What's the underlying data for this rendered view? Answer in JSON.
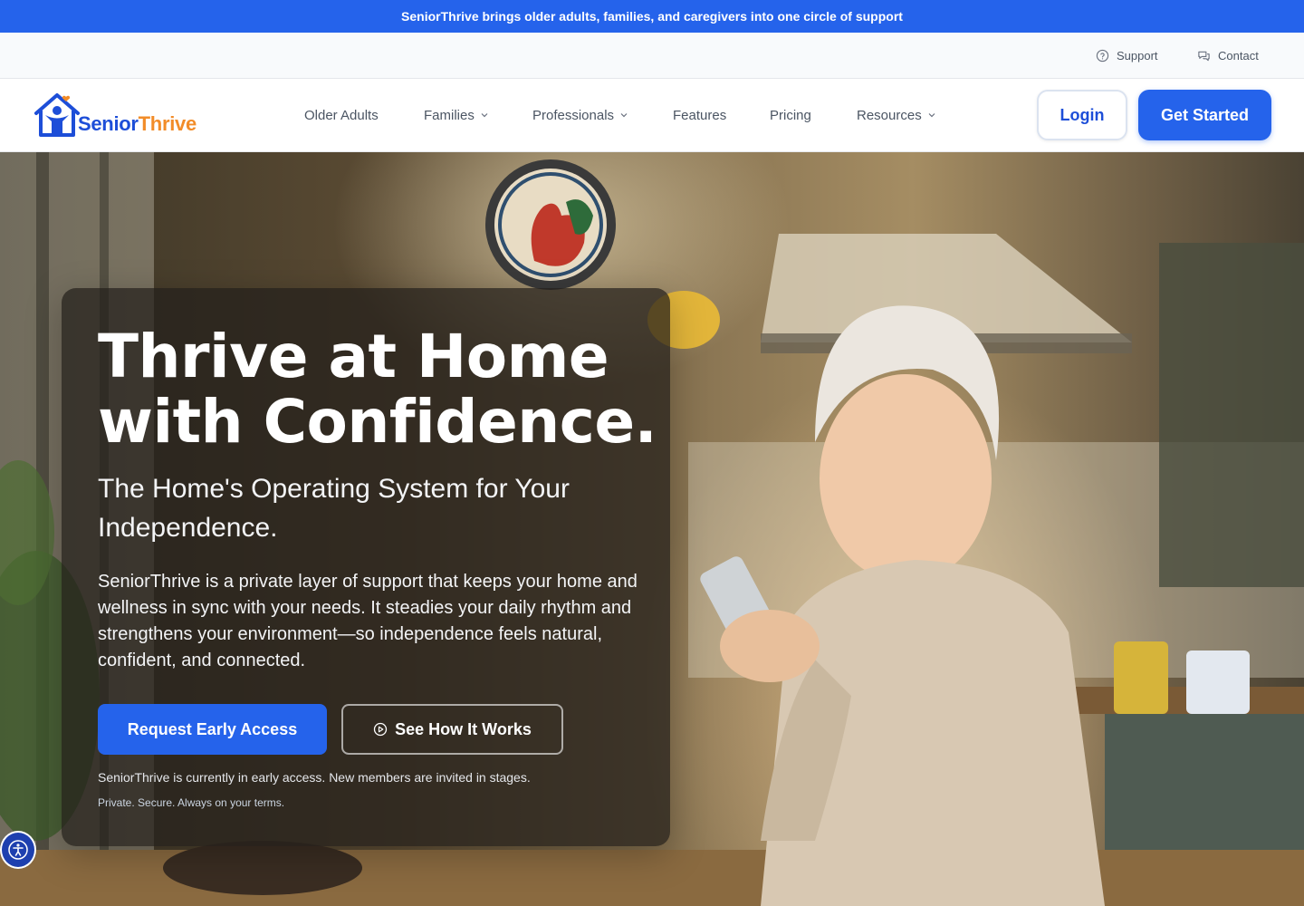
{
  "announcement": "SeniorThrive brings older adults, families, and caregivers into one circle of support",
  "utility": {
    "support": "Support",
    "contact": "Contact"
  },
  "brand": {
    "name_part1": "Senior",
    "name_part2": "Thrive",
    "primary_color": "#1d4ed8",
    "accent_color": "#f28c28"
  },
  "nav": {
    "items": [
      {
        "label": "Older Adults",
        "has_dropdown": false
      },
      {
        "label": "Families",
        "has_dropdown": true
      },
      {
        "label": "Professionals",
        "has_dropdown": true
      },
      {
        "label": "Features",
        "has_dropdown": false
      },
      {
        "label": "Pricing",
        "has_dropdown": false
      },
      {
        "label": "Resources",
        "has_dropdown": true
      }
    ],
    "login": "Login",
    "get_started": "Get Started"
  },
  "hero": {
    "title_line1": "Thrive at Home",
    "title_line2": "with Confidence.",
    "subtitle": "The Home's Operating System for Your Independence.",
    "body": "SeniorThrive is a private layer of support that keeps your home and wellness in sync with your needs. It steadies your daily rhythm and strengthens your environment—so independence feels natural, confident, and connected.",
    "cta_primary": "Request Early Access",
    "cta_secondary": "See How It Works",
    "note": "SeniorThrive is currently in early access. New members are invited in stages.",
    "fine_print": "Private. Secure. Always on your terms."
  },
  "icons": {
    "support": "question-circle-icon",
    "contact": "chat-bubbles-icon",
    "play": "play-circle-icon",
    "accessibility": "accessibility-icon",
    "dropdown": "chevron-down-icon"
  }
}
